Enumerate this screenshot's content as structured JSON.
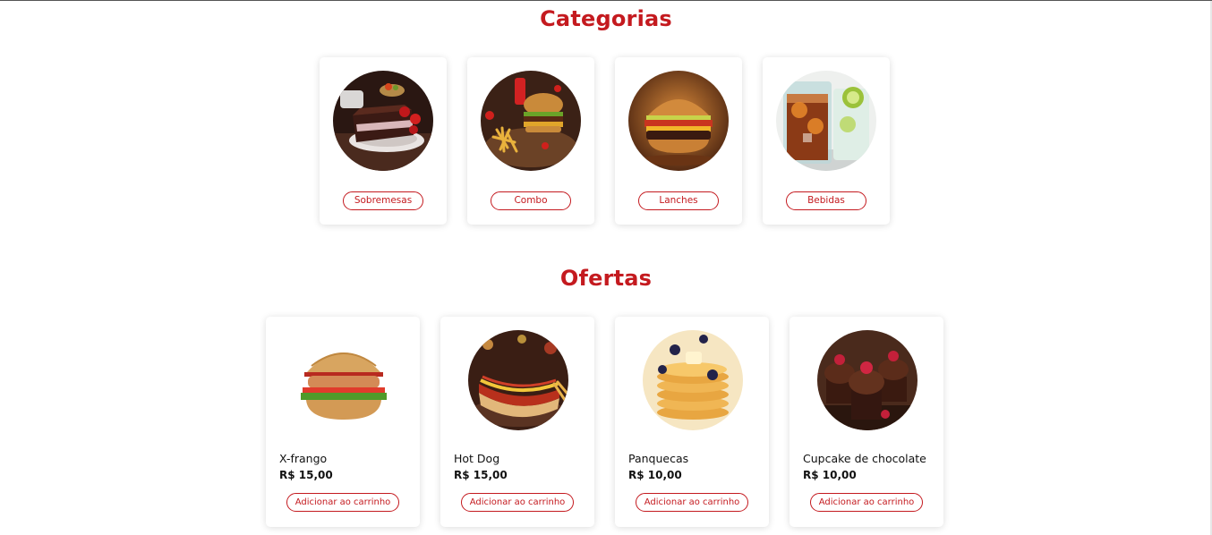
{
  "categories": {
    "title": "Categorias",
    "items": [
      {
        "label": "Sobremesas",
        "image": "cake-slice-image"
      },
      {
        "label": "Combo",
        "image": "burger-combo-image"
      },
      {
        "label": "Lanches",
        "image": "burger-image"
      },
      {
        "label": "Bebidas",
        "image": "soda-glass-image"
      }
    ]
  },
  "offers": {
    "title": "Ofertas",
    "add_label": "Adicionar ao carrinho",
    "items": [
      {
        "name": "X-frango",
        "price": "R$ 15,00",
        "image": "chicken-burger-image"
      },
      {
        "name": "Hot Dog",
        "price": "R$ 15,00",
        "image": "hot-dog-image"
      },
      {
        "name": "Panquecas",
        "price": "R$ 10,00",
        "image": "pancakes-image"
      },
      {
        "name": "Cupcake de chocolate",
        "price": "R$ 10,00",
        "image": "chocolate-cupcake-image"
      }
    ]
  },
  "colors": {
    "accent": "#c41a1f",
    "text": "#111111",
    "card_bg": "#ffffff"
  }
}
